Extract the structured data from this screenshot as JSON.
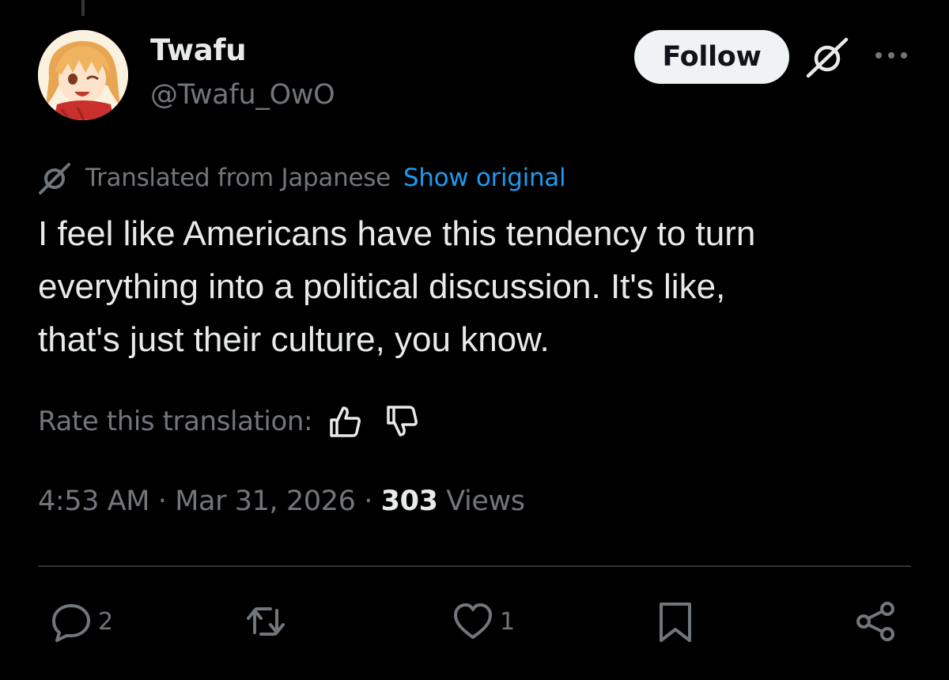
{
  "author": {
    "display_name": "Twafu",
    "handle": "@Twafu_OwO"
  },
  "header": {
    "follow_label": "Follow",
    "icons": [
      "grok-icon",
      "more-icon"
    ]
  },
  "translation": {
    "label": "Translated from Japanese",
    "show_original_label": "Show original"
  },
  "tweet": {
    "text": "I feel like Americans have this tendency to turn\neverything into a political discussion. It's like,\nthat's just their culture, you know."
  },
  "rate": {
    "label": "Rate this translation:"
  },
  "meta": {
    "time": "4:53 AM",
    "separator": " · ",
    "date": "Mar 31, 2026",
    "views_count": "303",
    "views_label": " Views"
  },
  "actions": {
    "reply_count": "2",
    "retweet_count": "",
    "like_count": "1"
  },
  "colors": {
    "background": "#000000",
    "text_primary": "#e7e9ea",
    "text_secondary": "#71767b",
    "link": "#1d9bf0",
    "divider": "#2f3336",
    "follow_button_bg": "#eff3f4"
  }
}
